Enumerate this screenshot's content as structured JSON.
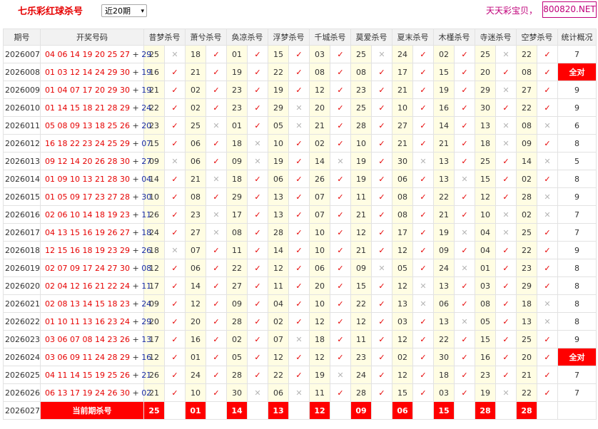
{
  "header": {
    "title": "七乐彩红球杀号",
    "period_select": "近20期",
    "promo_text": "天天彩宝贝，",
    "site_badge": "800820.NET"
  },
  "columns": [
    "期号",
    "开奖号码",
    "昔梦杀号",
    "萧兮杀号",
    "奂凉杀号",
    "浮梦杀号",
    "千城杀号",
    "莫爱杀号",
    "夏末杀号",
    "木槿杀号",
    "寺迷杀号",
    "空梦杀号",
    "统计概况"
  ],
  "rows": [
    {
      "issue": "2026007",
      "reds": "04 06 14 19 20 25 27",
      "blue": "29",
      "kills": [
        [
          "25",
          "x"
        ],
        [
          "18",
          "v"
        ],
        [
          "01",
          "v"
        ],
        [
          "15",
          "v"
        ],
        [
          "03",
          "v"
        ],
        [
          "25",
          "x"
        ],
        [
          "24",
          "v"
        ],
        [
          "02",
          "v"
        ],
        [
          "25",
          "x"
        ],
        [
          "22",
          "v"
        ]
      ],
      "stat": "7"
    },
    {
      "issue": "2026008",
      "reds": "01 03 12 14 24 29 30",
      "blue": "19",
      "kills": [
        [
          "16",
          "v"
        ],
        [
          "21",
          "v"
        ],
        [
          "19",
          "v"
        ],
        [
          "22",
          "v"
        ],
        [
          "08",
          "v"
        ],
        [
          "08",
          "v"
        ],
        [
          "17",
          "v"
        ],
        [
          "15",
          "v"
        ],
        [
          "20",
          "v"
        ],
        [
          "08",
          "v"
        ]
      ],
      "stat": "全对"
    },
    {
      "issue": "2026009",
      "reds": "01 04 07 17 20 29 30",
      "blue": "19",
      "kills": [
        [
          "21",
          "v"
        ],
        [
          "02",
          "v"
        ],
        [
          "23",
          "v"
        ],
        [
          "19",
          "v"
        ],
        [
          "12",
          "v"
        ],
        [
          "23",
          "v"
        ],
        [
          "21",
          "v"
        ],
        [
          "19",
          "v"
        ],
        [
          "29",
          "x"
        ],
        [
          "27",
          "v"
        ]
      ],
      "stat": "9"
    },
    {
      "issue": "2026010",
      "reds": "01 14 15 18 21 28 29",
      "blue": "24",
      "kills": [
        [
          "22",
          "v"
        ],
        [
          "02",
          "v"
        ],
        [
          "23",
          "v"
        ],
        [
          "29",
          "x"
        ],
        [
          "20",
          "v"
        ],
        [
          "25",
          "v"
        ],
        [
          "10",
          "v"
        ],
        [
          "16",
          "v"
        ],
        [
          "30",
          "v"
        ],
        [
          "22",
          "v"
        ]
      ],
      "stat": "9"
    },
    {
      "issue": "2026011",
      "reds": "05 08 09 13 18 25 26",
      "blue": "20",
      "kills": [
        [
          "23",
          "v"
        ],
        [
          "25",
          "x"
        ],
        [
          "01",
          "v"
        ],
        [
          "05",
          "x"
        ],
        [
          "21",
          "v"
        ],
        [
          "28",
          "v"
        ],
        [
          "27",
          "v"
        ],
        [
          "14",
          "v"
        ],
        [
          "13",
          "x"
        ],
        [
          "08",
          "x"
        ]
      ],
      "stat": "6"
    },
    {
      "issue": "2026012",
      "reds": "16 18 22 23 24 25 29",
      "blue": "07",
      "kills": [
        [
          "15",
          "v"
        ],
        [
          "06",
          "v"
        ],
        [
          "18",
          "x"
        ],
        [
          "10",
          "v"
        ],
        [
          "02",
          "v"
        ],
        [
          "10",
          "v"
        ],
        [
          "21",
          "v"
        ],
        [
          "21",
          "v"
        ],
        [
          "18",
          "x"
        ],
        [
          "09",
          "v"
        ]
      ],
      "stat": "8"
    },
    {
      "issue": "2026013",
      "reds": "09 12 14 20 26 28 30",
      "blue": "27",
      "kills": [
        [
          "09",
          "x"
        ],
        [
          "06",
          "v"
        ],
        [
          "09",
          "x"
        ],
        [
          "19",
          "v"
        ],
        [
          "14",
          "x"
        ],
        [
          "19",
          "v"
        ],
        [
          "30",
          "x"
        ],
        [
          "13",
          "v"
        ],
        [
          "25",
          "v"
        ],
        [
          "14",
          "x"
        ]
      ],
      "stat": "5"
    },
    {
      "issue": "2026014",
      "reds": "01 09 10 13 21 28 30",
      "blue": "04",
      "kills": [
        [
          "14",
          "v"
        ],
        [
          "21",
          "x"
        ],
        [
          "18",
          "v"
        ],
        [
          "06",
          "v"
        ],
        [
          "26",
          "v"
        ],
        [
          "19",
          "v"
        ],
        [
          "06",
          "v"
        ],
        [
          "13",
          "x"
        ],
        [
          "15",
          "v"
        ],
        [
          "02",
          "v"
        ]
      ],
      "stat": "8"
    },
    {
      "issue": "2026015",
      "reds": "01 05 09 17 23 27 28",
      "blue": "30",
      "kills": [
        [
          "10",
          "v"
        ],
        [
          "08",
          "v"
        ],
        [
          "29",
          "v"
        ],
        [
          "13",
          "v"
        ],
        [
          "07",
          "v"
        ],
        [
          "11",
          "v"
        ],
        [
          "08",
          "v"
        ],
        [
          "22",
          "v"
        ],
        [
          "12",
          "v"
        ],
        [
          "28",
          "x"
        ]
      ],
      "stat": "9"
    },
    {
      "issue": "2026016",
      "reds": "02 06 10 14 18 19 23",
      "blue": "11",
      "kills": [
        [
          "26",
          "v"
        ],
        [
          "23",
          "x"
        ],
        [
          "17",
          "v"
        ],
        [
          "13",
          "v"
        ],
        [
          "07",
          "v"
        ],
        [
          "21",
          "v"
        ],
        [
          "08",
          "v"
        ],
        [
          "21",
          "v"
        ],
        [
          "10",
          "x"
        ],
        [
          "02",
          "x"
        ]
      ],
      "stat": "7"
    },
    {
      "issue": "2026017",
      "reds": "04 13 15 16 19 26 27",
      "blue": "18",
      "kills": [
        [
          "24",
          "v"
        ],
        [
          "27",
          "x"
        ],
        [
          "08",
          "v"
        ],
        [
          "28",
          "v"
        ],
        [
          "10",
          "v"
        ],
        [
          "12",
          "v"
        ],
        [
          "17",
          "v"
        ],
        [
          "19",
          "x"
        ],
        [
          "04",
          "x"
        ],
        [
          "25",
          "v"
        ]
      ],
      "stat": "7"
    },
    {
      "issue": "2026018",
      "reds": "12 15 16 18 19 23 29",
      "blue": "26",
      "kills": [
        [
          "18",
          "x"
        ],
        [
          "07",
          "v"
        ],
        [
          "11",
          "v"
        ],
        [
          "14",
          "v"
        ],
        [
          "10",
          "v"
        ],
        [
          "21",
          "v"
        ],
        [
          "12",
          "v"
        ],
        [
          "09",
          "v"
        ],
        [
          "04",
          "v"
        ],
        [
          "22",
          "v"
        ]
      ],
      "stat": "9"
    },
    {
      "issue": "2026019",
      "reds": "02 07 09 17 24 27 30",
      "blue": "08",
      "kills": [
        [
          "12",
          "v"
        ],
        [
          "06",
          "v"
        ],
        [
          "22",
          "v"
        ],
        [
          "12",
          "v"
        ],
        [
          "06",
          "v"
        ],
        [
          "09",
          "x"
        ],
        [
          "05",
          "v"
        ],
        [
          "24",
          "x"
        ],
        [
          "01",
          "v"
        ],
        [
          "23",
          "v"
        ]
      ],
      "stat": "8"
    },
    {
      "issue": "2026020",
      "reds": "02 04 12 16 21 22 24",
      "blue": "11",
      "kills": [
        [
          "17",
          "v"
        ],
        [
          "14",
          "v"
        ],
        [
          "27",
          "v"
        ],
        [
          "11",
          "v"
        ],
        [
          "20",
          "v"
        ],
        [
          "15",
          "v"
        ],
        [
          "12",
          "x"
        ],
        [
          "13",
          "v"
        ],
        [
          "03",
          "v"
        ],
        [
          "29",
          "v"
        ]
      ],
      "stat": "8"
    },
    {
      "issue": "2026021",
      "reds": "02 08 13 14 15 18 23",
      "blue": "24",
      "kills": [
        [
          "09",
          "v"
        ],
        [
          "12",
          "v"
        ],
        [
          "09",
          "v"
        ],
        [
          "04",
          "v"
        ],
        [
          "10",
          "v"
        ],
        [
          "22",
          "v"
        ],
        [
          "13",
          "x"
        ],
        [
          "06",
          "v"
        ],
        [
          "08",
          "v"
        ],
        [
          "18",
          "x"
        ]
      ],
      "stat": "8"
    },
    {
      "issue": "2026022",
      "reds": "01 10 11 13 16 23 24",
      "blue": "29",
      "kills": [
        [
          "20",
          "v"
        ],
        [
          "20",
          "v"
        ],
        [
          "28",
          "v"
        ],
        [
          "02",
          "v"
        ],
        [
          "12",
          "v"
        ],
        [
          "12",
          "v"
        ],
        [
          "03",
          "v"
        ],
        [
          "13",
          "x"
        ],
        [
          "05",
          "v"
        ],
        [
          "13",
          "x"
        ]
      ],
      "stat": "8"
    },
    {
      "issue": "2026023",
      "reds": "03 06 07 08 14 23 26",
      "blue": "13",
      "kills": [
        [
          "17",
          "v"
        ],
        [
          "16",
          "v"
        ],
        [
          "02",
          "v"
        ],
        [
          "07",
          "x"
        ],
        [
          "18",
          "v"
        ],
        [
          "11",
          "v"
        ],
        [
          "12",
          "v"
        ],
        [
          "22",
          "v"
        ],
        [
          "15",
          "v"
        ],
        [
          "25",
          "v"
        ]
      ],
      "stat": "9"
    },
    {
      "issue": "2026024",
      "reds": "03 06 09 11 24 28 29",
      "blue": "16",
      "kills": [
        [
          "12",
          "v"
        ],
        [
          "01",
          "v"
        ],
        [
          "05",
          "v"
        ],
        [
          "12",
          "v"
        ],
        [
          "12",
          "v"
        ],
        [
          "23",
          "v"
        ],
        [
          "02",
          "v"
        ],
        [
          "30",
          "v"
        ],
        [
          "16",
          "v"
        ],
        [
          "20",
          "v"
        ]
      ],
      "stat": "全对"
    },
    {
      "issue": "2026025",
      "reds": "04 11 14 15 19 25 26",
      "blue": "21",
      "kills": [
        [
          "26",
          "v"
        ],
        [
          "24",
          "v"
        ],
        [
          "28",
          "v"
        ],
        [
          "22",
          "v"
        ],
        [
          "19",
          "x"
        ],
        [
          "24",
          "v"
        ],
        [
          "12",
          "v"
        ],
        [
          "18",
          "v"
        ],
        [
          "23",
          "v"
        ],
        [
          "21",
          "v"
        ]
      ],
      "stat": "7"
    },
    {
      "issue": "2026026",
      "reds": "06 13 17 19 24 26 30",
      "blue": "02",
      "kills": [
        [
          "21",
          "v"
        ],
        [
          "10",
          "v"
        ],
        [
          "30",
          "x"
        ],
        [
          "06",
          "x"
        ],
        [
          "11",
          "v"
        ],
        [
          "28",
          "v"
        ],
        [
          "15",
          "v"
        ],
        [
          "03",
          "v"
        ],
        [
          "19",
          "x"
        ],
        [
          "22",
          "v"
        ]
      ],
      "stat": "7"
    }
  ],
  "current": {
    "issue": "2026027",
    "label": "当前期杀号",
    "kills": [
      "25",
      "01",
      "14",
      "13",
      "12",
      "09",
      "06",
      "15",
      "28",
      "28"
    ]
  },
  "symbols": {
    "check": "✓",
    "cross": "✕"
  },
  "colors": {
    "red": "#e60000",
    "blue": "#1a2ea6",
    "kill_bg": "#fffde3",
    "header_bg": "#f2f2f2"
  }
}
